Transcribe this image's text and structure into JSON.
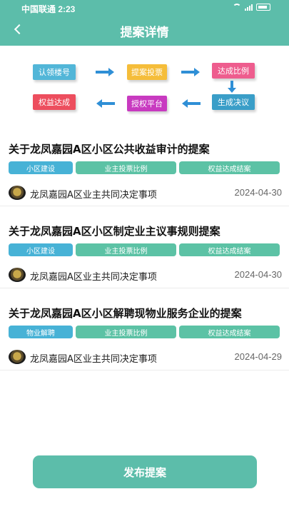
{
  "status": {
    "time_text": "中国联通 2:23"
  },
  "header": {
    "title": "提案详情"
  },
  "flow": {
    "steps": [
      "认领楼号",
      "提案投票",
      "达成比例",
      "生成决议",
      "授权平台",
      "权益达成"
    ]
  },
  "proposals": [
    {
      "title": "关于龙凤嘉园A区小区公共收益审计的提案",
      "tags": [
        "小区建设",
        "业主投票比例",
        "权益达成结案"
      ],
      "author": "龙凤嘉园A区业主共同决定事项",
      "date": "2024-04-30"
    },
    {
      "title": "关于龙凤嘉园A区小区制定业主议事规则提案",
      "tags": [
        "小区建设",
        "业主投票比例",
        "权益达成结案"
      ],
      "author": "龙凤嘉园A区业主共同决定事项",
      "date": "2024-04-30"
    },
    {
      "title": "关于龙凤嘉园A区小区解聘现物业服务企业的提案",
      "tags": [
        "物业解聘",
        "业主投票比例",
        "权益达成结案"
      ],
      "author": "龙凤嘉园A区业主共同决定事项",
      "date": "2024-04-29"
    }
  ],
  "footer": {
    "publish_label": "发布提案"
  },
  "colors": {
    "header": "#5cbdaa",
    "tag_category": "#47b2d6",
    "tag_status": "#5cc2a5"
  }
}
